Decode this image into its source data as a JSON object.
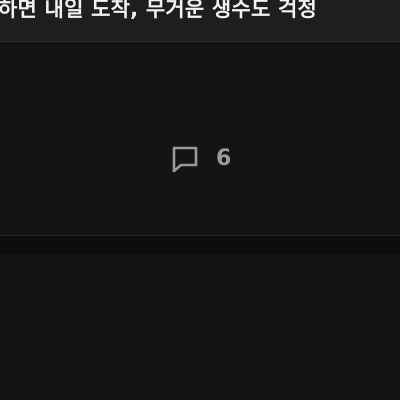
{
  "article": {
    "headline_fragment": "하면 내일 도착, 무거운 생수도 걱정"
  },
  "comments": {
    "count": "6",
    "icon": "speech-bubble-icon"
  }
}
